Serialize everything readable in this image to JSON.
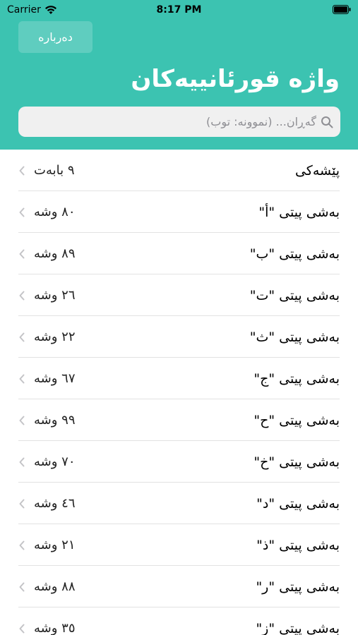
{
  "status_bar": {
    "carrier": "Carrier",
    "time": "8:17 PM"
  },
  "header": {
    "about_label": "دەربارە",
    "title": "واژە قورئانییەکان",
    "search_placeholder": "گەڕان... (نموونە: توب)"
  },
  "list": {
    "items": [
      {
        "title": "پێشەکی",
        "count": "٩ بابەت"
      },
      {
        "title": "بەشی پیتی \"أ\"",
        "count": "٨٠ وشە"
      },
      {
        "title": "بەشی پیتی \"ب\"",
        "count": "٨٩ وشە"
      },
      {
        "title": "بەشی پیتی \"ت\"",
        "count": "٢٦ وشە"
      },
      {
        "title": "بەشی پیتی \"ث\"",
        "count": "٢٢ وشە"
      },
      {
        "title": "بەشی پیتی \"ج\"",
        "count": "٦٧ وشە"
      },
      {
        "title": "بەشی پیتی \"ح\"",
        "count": "٩٩ وشە"
      },
      {
        "title": "بەشی پیتی \"خ\"",
        "count": "٧٠ وشە"
      },
      {
        "title": "بەشی پیتی \"د\"",
        "count": "٤٦ وشە"
      },
      {
        "title": "بەشی پیتی \"ذ\"",
        "count": "٢١ وشە"
      },
      {
        "title": "بەشی پیتی \"ر\"",
        "count": "٨٨ وشە"
      },
      {
        "title": "بەشی پیتی \"ز\"",
        "count": "٣٥ وشە"
      }
    ]
  },
  "colors": {
    "header_bg": "#3cc3b1",
    "separator": "#e2e2e2"
  }
}
